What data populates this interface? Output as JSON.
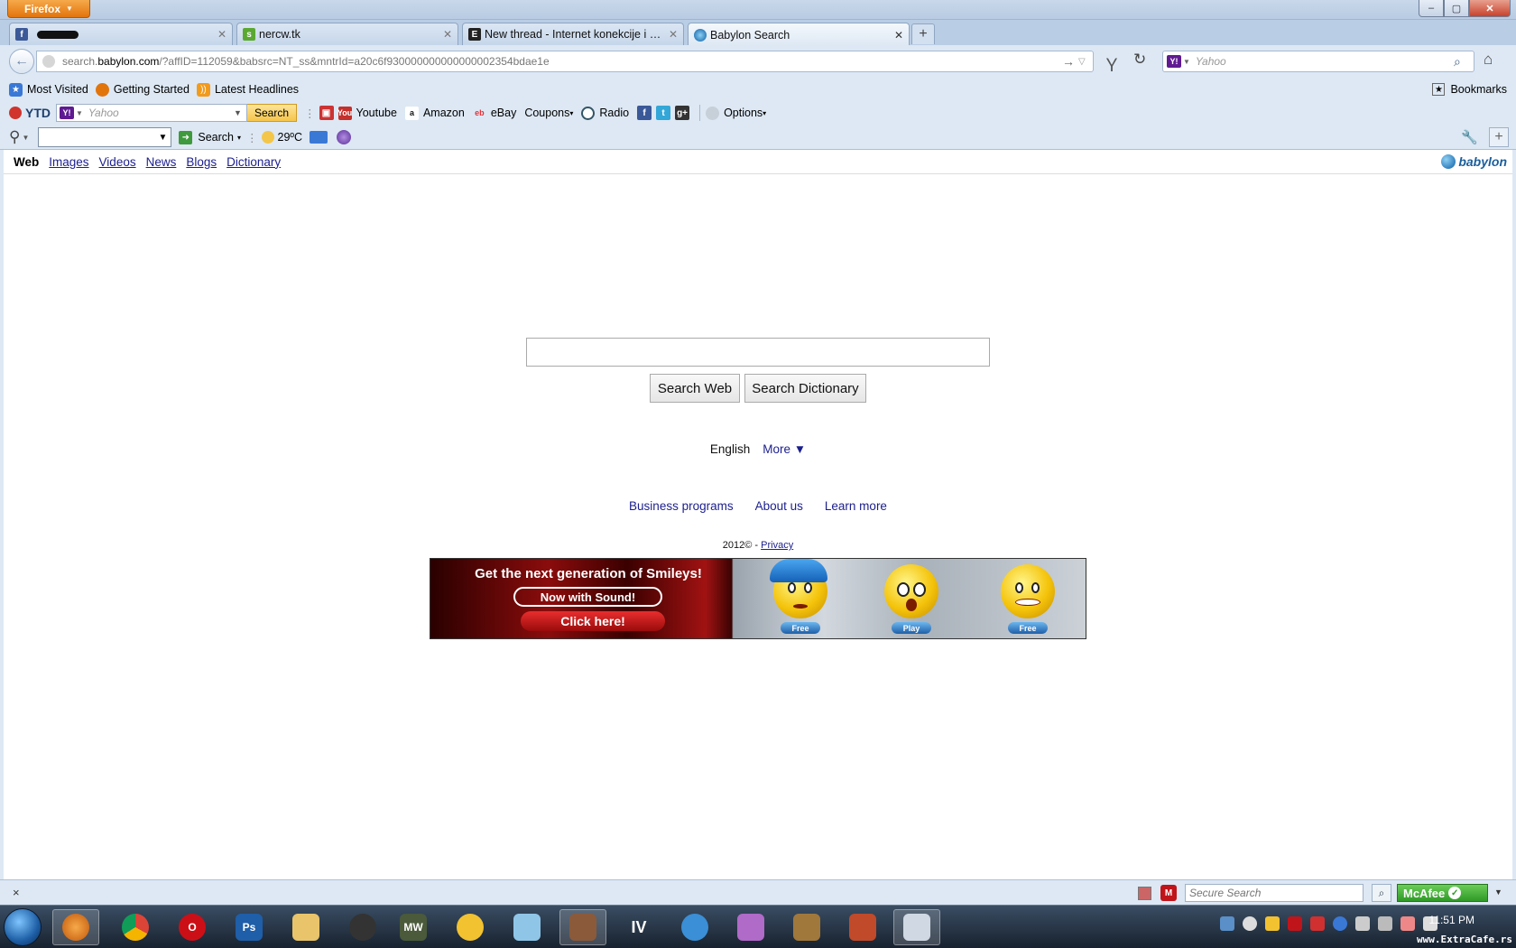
{
  "window": {
    "app_button": "Firefox",
    "min": "–",
    "max": "▢",
    "close": "✕"
  },
  "tabs": [
    {
      "title": "",
      "favicon": "facebook-icon",
      "color": "#3b5998"
    },
    {
      "title": "nercw.tk",
      "favicon": "site-icon",
      "color": "#5aa832"
    },
    {
      "title": "New thread - Internet konekcije i klije...",
      "favicon": "forum-icon",
      "color": "#222222"
    },
    {
      "title": "Babylon Search",
      "favicon": "babylon-icon",
      "color": "#0a5ea6"
    }
  ],
  "navbar": {
    "url_prefix": "search.",
    "url_domain": "babylon.com",
    "url_rest": "/?affID=112059&babsrc=NT_ss&mntrId=a20c6f930000000000000002354bdae1e",
    "search_placeholder": "Yahoo"
  },
  "bookmarks": {
    "items": [
      {
        "label": "Most Visited",
        "icon": "most-visited-icon",
        "color": "#3a78d6"
      },
      {
        "label": "Getting Started",
        "icon": "firefox-icon",
        "color": "#e2740c"
      },
      {
        "label": "Latest Headlines",
        "icon": "rss-icon",
        "color": "#f29a1c"
      }
    ],
    "menu_label": "Bookmarks"
  },
  "ytd": {
    "logo": "YTD",
    "search_placeholder": "Yahoo",
    "search_button": "Search",
    "youtube": "Youtube",
    "amazon": "Amazon",
    "ebay": "eBay",
    "coupons": "Coupons",
    "radio": "Radio",
    "options": "Options"
  },
  "weatherbar": {
    "search_label": "Search",
    "temperature": "29ºC"
  },
  "page": {
    "vertical_nav": [
      "Web",
      "Images",
      "Videos",
      "News",
      "Blogs",
      "Dictionary"
    ],
    "logo": "babylon",
    "search_value": "",
    "search_web_button": "Search Web",
    "search_dictionary_button": "Search Dictionary",
    "language": "English",
    "more": "More ▼",
    "footer_links": [
      "Business programs",
      "About us",
      "Learn more"
    ],
    "copyright": "2012© - ",
    "privacy": "Privacy"
  },
  "banner": {
    "headline": "Get the next generation of Smileys!",
    "sound": "Now with Sound!",
    "cta": "Click here!",
    "buttons": [
      "Free",
      "Play",
      "Free"
    ]
  },
  "addonbar": {
    "close": "×",
    "secure_search_placeholder": "Secure Search",
    "mcafee": "McAfee"
  },
  "taskbar": {
    "clock": "11:51 PM",
    "watermark": "www.ExtraCafe.rs"
  }
}
